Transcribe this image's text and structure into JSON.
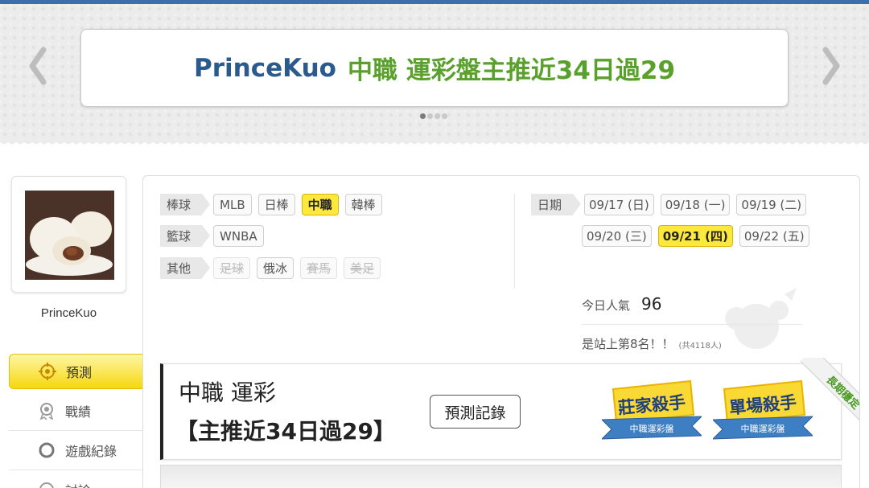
{
  "colors": {
    "top_stripe": "#3f6fa8",
    "banner_name": "#2b5a8c",
    "banner_title": "#5aa02c",
    "active_chip": "#fde93d"
  },
  "banner": {
    "name": "PrinceKuo",
    "title": "中職 運彩盤主推近34日過29",
    "slide_count": 4,
    "active_slide": 1
  },
  "profile": {
    "name": "PrinceKuo"
  },
  "side_nav": {
    "items": [
      {
        "label": "預測",
        "icon": "target-icon",
        "active": true
      },
      {
        "label": "戰績",
        "icon": "medal-icon",
        "active": false
      },
      {
        "label": "遊戲紀錄",
        "icon": "circle-icon",
        "active": false
      },
      {
        "label": "討論",
        "icon": "chat-icon",
        "active": false
      }
    ]
  },
  "filters": {
    "baseball": {
      "label": "棒球",
      "chips": [
        "MLB",
        "日棒",
        "中職",
        "韓棒"
      ],
      "active": "中職"
    },
    "basketball": {
      "label": "籃球",
      "chips": [
        "WNBA"
      ]
    },
    "other": {
      "label": "其他",
      "chips": [
        "足球",
        "俄冰",
        "賽馬",
        "美足"
      ],
      "disabled": [
        "足球",
        "賽馬",
        "美足"
      ]
    }
  },
  "dates": {
    "label": "日期",
    "items": [
      "09/17 (日)",
      "09/18 (一)",
      "09/19 (二)",
      "09/20 (三)",
      "09/21 (四)",
      "09/22 (五)"
    ],
    "active": "09/21 (四)"
  },
  "stats": {
    "popularity_label": "今日人氣",
    "popularity_value": "96",
    "rank_text": "是站上第8名！！",
    "rank_total": "(共4118人)"
  },
  "article": {
    "title": "中職 運彩",
    "subtitle": "【主推近34日過29】",
    "record_button": "預測記錄"
  },
  "badges": [
    {
      "title": "莊家殺手",
      "sub": "中職運彩盤"
    },
    {
      "title": "單場殺手",
      "sub": "中職運彩盤"
    }
  ],
  "ribbon": "長期穩定"
}
